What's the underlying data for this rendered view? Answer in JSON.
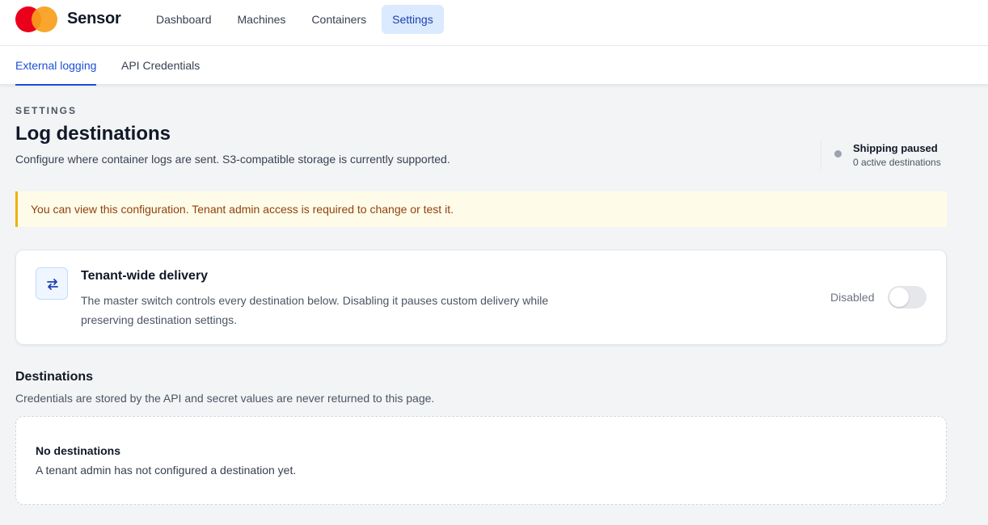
{
  "app": {
    "brand": "Sensor",
    "logo_colors": [
      "#eb001b",
      "#f79e1b"
    ]
  },
  "nav": {
    "items": [
      {
        "label": "Dashboard",
        "active": false
      },
      {
        "label": "Machines",
        "active": false
      },
      {
        "label": "Containers",
        "active": false
      },
      {
        "label": "Settings",
        "active": true
      }
    ]
  },
  "subtabs": [
    {
      "label": "External logging",
      "active": true
    },
    {
      "label": "API Credentials",
      "active": false
    }
  ],
  "header": {
    "eyebrow": "SETTINGS",
    "title": "Log destinations",
    "subtitle": "Configure where container logs are sent. S3-compatible storage is currently supported."
  },
  "status": {
    "title": "Shipping paused",
    "detail": "0 active destinations",
    "dot_color": "#9ca3af"
  },
  "notice": {
    "text": "You can view this configuration. Tenant admin access is required to change or test it."
  },
  "tenant": {
    "icon": "swap-arrows-icon",
    "title": "Tenant-wide delivery",
    "description": "The master switch controls every destination below. Disabling it pauses custom delivery while preserving destination settings.",
    "state_label": "Disabled",
    "enabled": false
  },
  "destinations": {
    "title": "Destinations",
    "subtitle": "Credentials are stored by the API and secret values are never returned to this page.",
    "empty_title": "No destinations",
    "empty_text": "A tenant admin has not configured a destination yet."
  }
}
